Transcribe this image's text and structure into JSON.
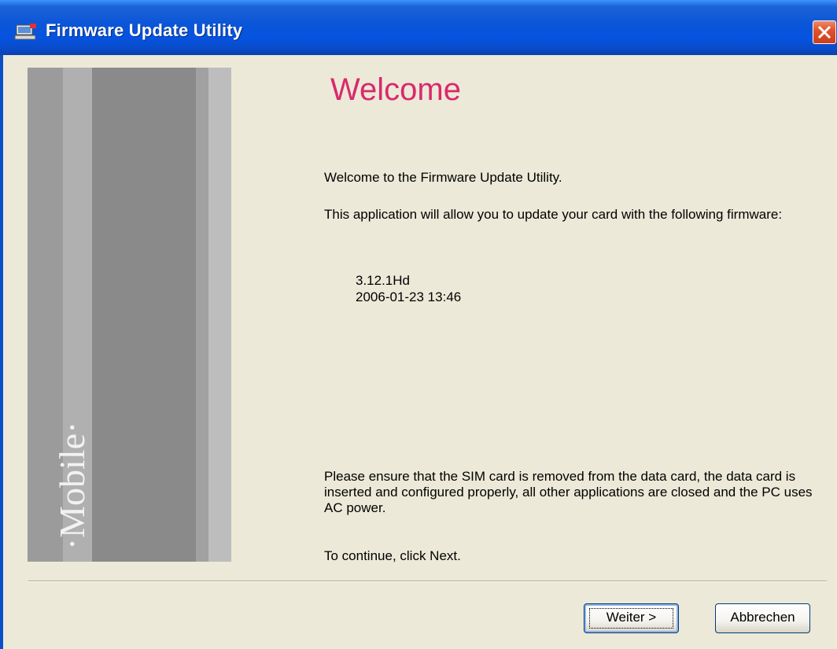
{
  "window": {
    "title": "Firmware Update Utility",
    "app_icon": "computer-icon",
    "close_icon": "close-icon"
  },
  "banner": {
    "brand_logo": "T-Mobile"
  },
  "content": {
    "heading": "Welcome",
    "welcome_text": "Welcome to the Firmware Update Utility.",
    "allow_text": "This application will allow you to update your card with the following firmware:",
    "firmware_version": "3.12.1Hd",
    "firmware_date": "2006-01-23 13:46",
    "ensure_text": "Please ensure that the SIM card is removed from the data card, the data card is inserted and configured properly, all other applications are closed and the PC uses AC power.",
    "continue_text": "To continue, click Next."
  },
  "buttons": {
    "next_label": "Weiter >",
    "cancel_label": "Abbrechen"
  },
  "colors": {
    "titlebar_blue": "#0553e0",
    "heading_magenta": "#d9296c",
    "brand_magenta": "#e20074",
    "dialog_bg": "#ece9d8"
  }
}
